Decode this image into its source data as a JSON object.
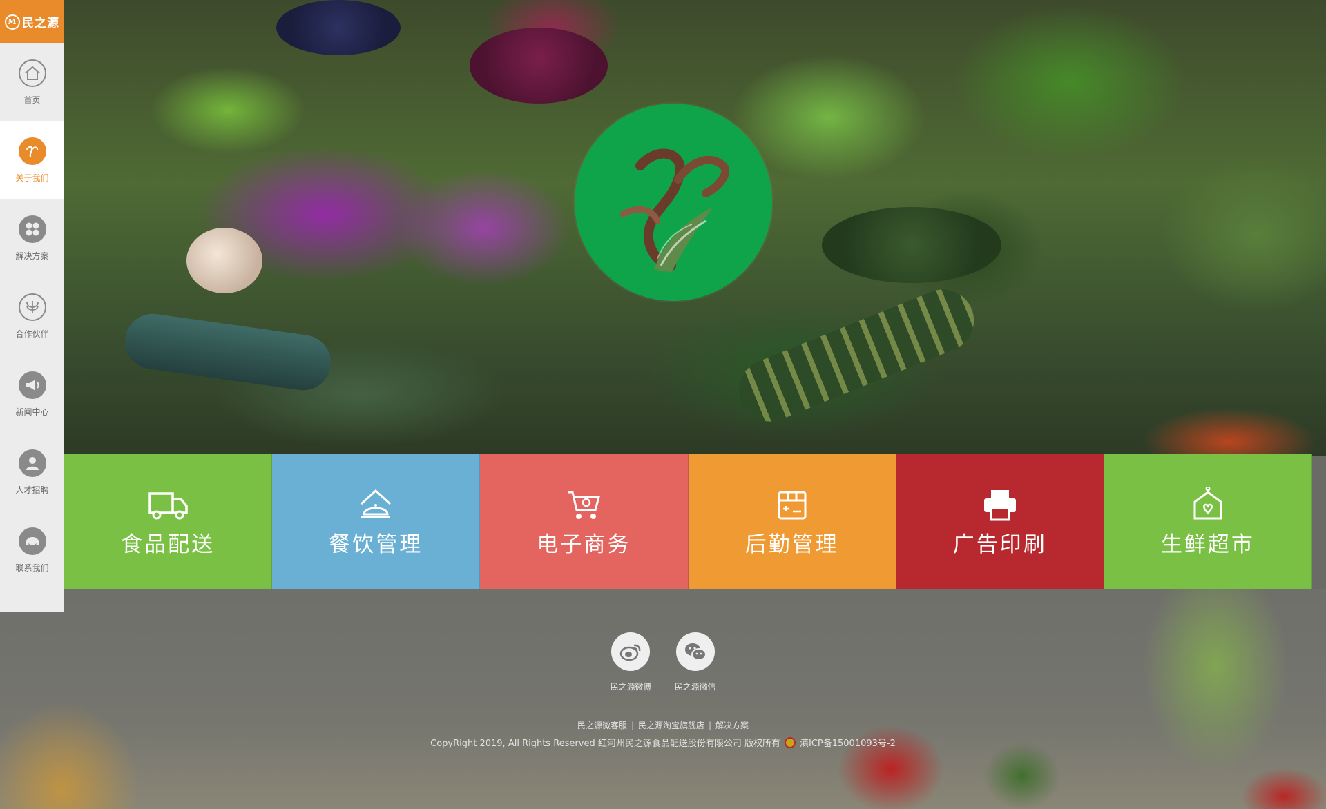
{
  "brand": {
    "logo_text": "民之源"
  },
  "sidebar": {
    "items": [
      {
        "label": "首页",
        "icon": "home-icon",
        "active": false
      },
      {
        "label": "关于我们",
        "icon": "brand-icon",
        "active": true
      },
      {
        "label": "解决方案",
        "icon": "grid-icon",
        "active": false
      },
      {
        "label": "合作伙伴",
        "icon": "partner-icon",
        "active": false
      },
      {
        "label": "新闻中心",
        "icon": "megaphone-icon",
        "active": false
      },
      {
        "label": "人才招聘",
        "icon": "person-icon",
        "active": false
      },
      {
        "label": "联系我们",
        "icon": "headset-icon",
        "active": false
      }
    ]
  },
  "tiles": [
    {
      "label": "食品配送",
      "icon": "truck-icon",
      "color": "#7ac044"
    },
    {
      "label": "餐饮管理",
      "icon": "cloche-icon",
      "color": "#6ab0d4"
    },
    {
      "label": "电子商务",
      "icon": "cart-icon",
      "color": "#e4655f"
    },
    {
      "label": "后勤管理",
      "icon": "box-icon",
      "color": "#ef9a33"
    },
    {
      "label": "广告印刷",
      "icon": "printer-icon",
      "color": "#b7292e"
    },
    {
      "label": "生鲜超市",
      "icon": "store-icon",
      "color": "#7ac044"
    }
  ],
  "footer": {
    "social": [
      {
        "label": "民之源微博",
        "icon": "weibo-icon"
      },
      {
        "label": "民之源微信",
        "icon": "wechat-icon"
      }
    ],
    "links": [
      "民之源微客服",
      "民之源淘宝旗舰店",
      "解决方案"
    ],
    "copyright": "CopyRight 2019, All Rights Reserved 红河州民之源食品配送股份有限公司 版权所有",
    "icp": "滇ICP备15001093号-2"
  },
  "colors": {
    "accent": "#e98a2b",
    "logo_green": "#0fa44a"
  }
}
